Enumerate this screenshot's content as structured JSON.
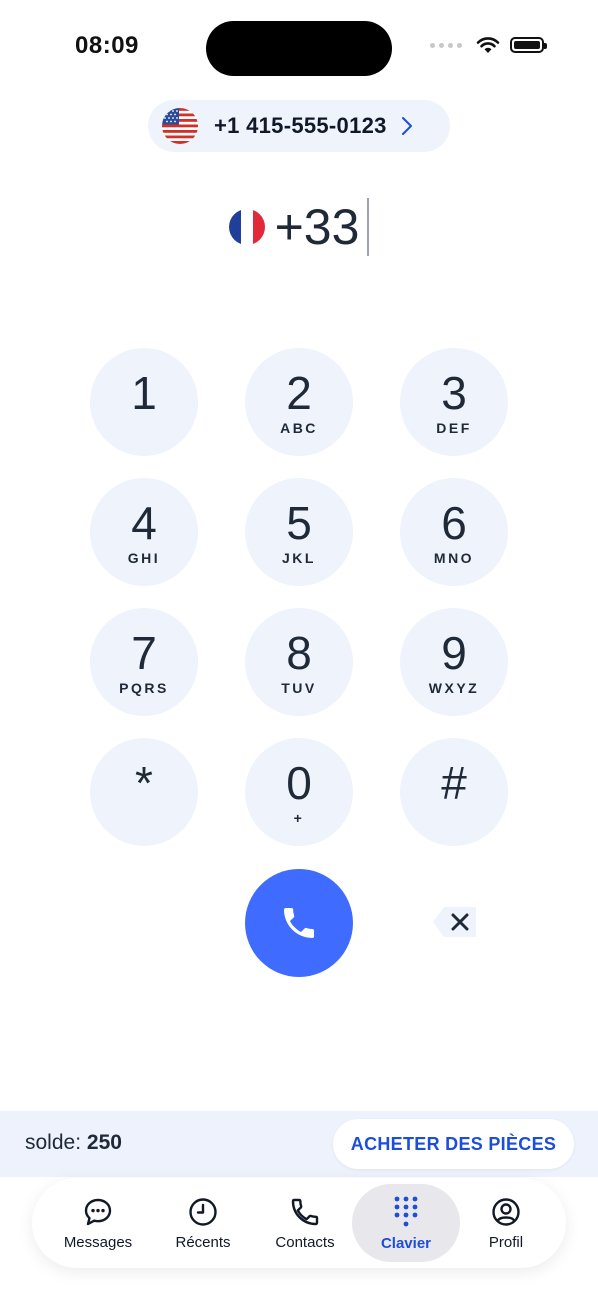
{
  "status_bar": {
    "time": "08:09"
  },
  "caller_id": {
    "flag": "us-flag-icon",
    "number": "+1 415-555-0123"
  },
  "dialer": {
    "flag": "fr-flag-icon",
    "value": "+33"
  },
  "keypad": {
    "keys": [
      {
        "digit": "1",
        "letters": ""
      },
      {
        "digit": "2",
        "letters": "ABC"
      },
      {
        "digit": "3",
        "letters": "DEF"
      },
      {
        "digit": "4",
        "letters": "GHI"
      },
      {
        "digit": "5",
        "letters": "JKL"
      },
      {
        "digit": "6",
        "letters": "MNO"
      },
      {
        "digit": "7",
        "letters": "PQRS"
      },
      {
        "digit": "8",
        "letters": "TUV"
      },
      {
        "digit": "9",
        "letters": "WXYZ"
      },
      {
        "digit": "*",
        "letters": ""
      },
      {
        "digit": "0",
        "letters": "+"
      },
      {
        "digit": "#",
        "letters": ""
      }
    ]
  },
  "balance": {
    "label": "solde:",
    "amount": "250"
  },
  "buy_button": {
    "label": "ACHETER DES PIÈCES"
  },
  "tabs": [
    {
      "label": "Messages",
      "icon": "chat-bubble-icon"
    },
    {
      "label": "Récents",
      "icon": "clock-icon"
    },
    {
      "label": "Contacts",
      "icon": "phone-icon"
    },
    {
      "label": "Clavier",
      "icon": "keypad-icon",
      "active": true
    },
    {
      "label": "Profil",
      "icon": "user-circle-icon"
    }
  ],
  "colors": {
    "accent": "#3f6bff",
    "key_bg": "#eef3fc",
    "active_tab_text": "#1d4ed8"
  }
}
